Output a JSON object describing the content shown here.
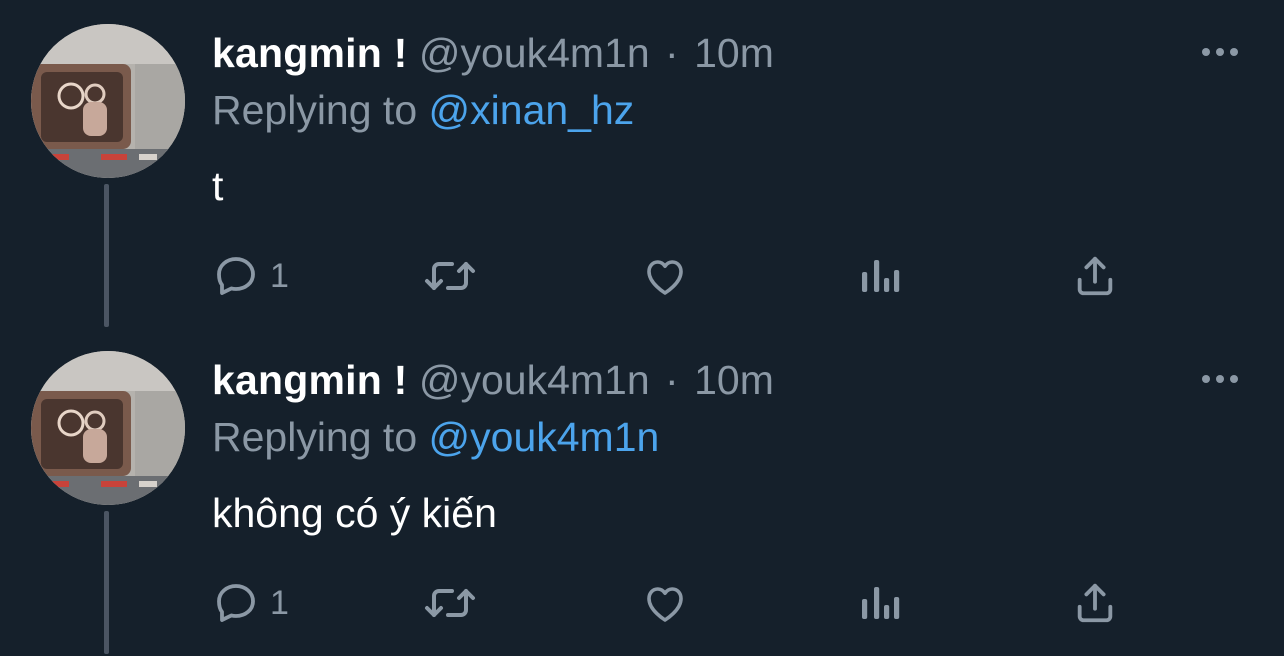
{
  "tweets": [
    {
      "display_name": "kangmin !",
      "handle": "@youk4m1n",
      "separator": "·",
      "time": "10m",
      "reply_prefix": "Replying to",
      "reply_to": "@xinan_hz",
      "text": "t",
      "reply_count": "1"
    },
    {
      "display_name": "kangmin !",
      "handle": "@youk4m1n",
      "separator": "·",
      "time": "10m",
      "reply_prefix": "Replying to",
      "reply_to": "@youk4m1n",
      "text": "không có ý kiến",
      "reply_count": "1"
    }
  ],
  "colors": {
    "background": "#15202b",
    "text_primary": "#ffffff",
    "text_secondary": "#8b98a5",
    "link": "#4ca4ec",
    "thread_line": "#4b5563"
  },
  "icons": [
    "more-icon",
    "reply-icon",
    "retweet-icon",
    "like-icon",
    "views-icon",
    "share-icon"
  ]
}
